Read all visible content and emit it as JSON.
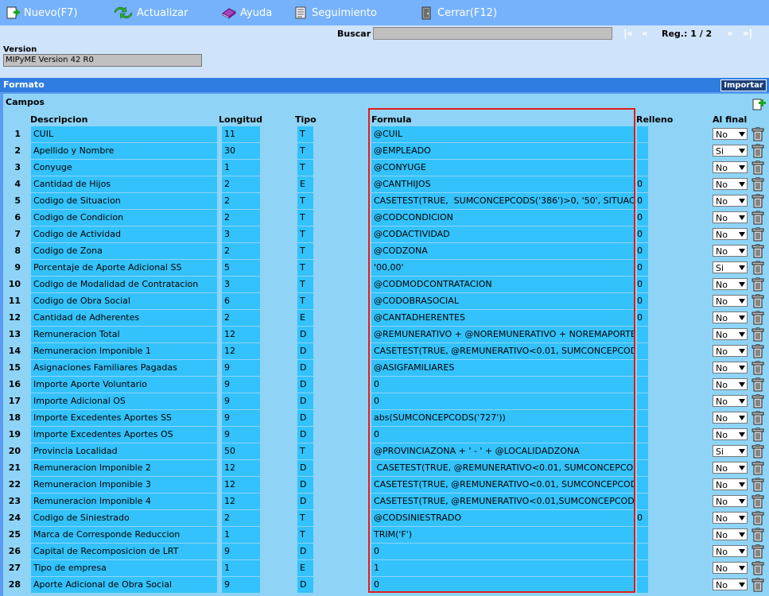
{
  "toolbar": {
    "nuevo": "Nuevo(F7)",
    "actualizar": "Actualizar",
    "ayuda": "Ayuda",
    "seguimiento": "Seguimiento",
    "cerrar": "Cerrar(F12)"
  },
  "search": {
    "label": "Buscar",
    "value": "",
    "nav_first": "|«",
    "nav_prev": "«",
    "reg": "Reg.: 1 / 2",
    "nav_next": "»",
    "nav_last": "»|"
  },
  "version": {
    "label": "Version",
    "value": "MIPyME Version 42 R0"
  },
  "formato": {
    "title": "Formato",
    "importar": "Importar"
  },
  "campos": {
    "title": "Campos",
    "headers": {
      "descripcion": "Descripcion",
      "longitud": "Longitud",
      "tipo": "Tipo",
      "formula": "Formula",
      "relleno": "Relleno",
      "al_final": "Al final"
    },
    "rows": [
      {
        "num": "1",
        "desc": "CUIL",
        "len": "11",
        "tipo": "T",
        "formula": "@CUIL",
        "relleno": "",
        "al_final": "No"
      },
      {
        "num": "2",
        "desc": "Apellido y Nombre",
        "len": "30",
        "tipo": "T",
        "formula": "@EMPLEADO",
        "relleno": "",
        "al_final": "Si"
      },
      {
        "num": "3",
        "desc": "Conyuge",
        "len": "1",
        "tipo": "T",
        "formula": "@CONYUGE",
        "relleno": "",
        "al_final": "No"
      },
      {
        "num": "4",
        "desc": "Cantidad de Hijos",
        "len": "2",
        "tipo": "E",
        "formula": "@CANTHIJOS",
        "relleno": "0",
        "al_final": "No"
      },
      {
        "num": "5",
        "desc": "Codigo de Situacion",
        "len": "2",
        "tipo": "T",
        "formula": "CASETEST(TRUE,  SUMCONCEPCODS('386')>0, '50', SITUACION",
        "relleno": "0",
        "al_final": "No"
      },
      {
        "num": "6",
        "desc": "Codigo de Condicion",
        "len": "2",
        "tipo": "T",
        "formula": "@CODCONDICION",
        "relleno": "0",
        "al_final": "No"
      },
      {
        "num": "7",
        "desc": "Codigo de Actividad",
        "len": "3",
        "tipo": "T",
        "formula": "@CODACTIVIDAD",
        "relleno": "0",
        "al_final": "No"
      },
      {
        "num": "8",
        "desc": "Codigo de Zona",
        "len": "2",
        "tipo": "T",
        "formula": "@CODZONA",
        "relleno": "0",
        "al_final": "No"
      },
      {
        "num": "9",
        "desc": "Porcentaje de Aporte Adicional SS",
        "len": "5",
        "tipo": "T",
        "formula": "'00,00'",
        "relleno": "0",
        "al_final": "Si"
      },
      {
        "num": "10",
        "desc": "Codigo de Modalidad de Contratacion",
        "len": "3",
        "tipo": "T",
        "formula": "@CODMODCONTRATACION",
        "relleno": "0",
        "al_final": "No"
      },
      {
        "num": "11",
        "desc": "Codigo de Obra Social",
        "len": "6",
        "tipo": "T",
        "formula": "@CODOBRASOCIAL",
        "relleno": "0",
        "al_final": "No"
      },
      {
        "num": "12",
        "desc": "Cantidad de Adherentes",
        "len": "2",
        "tipo": "E",
        "formula": "@CANTADHERENTES",
        "relleno": "0",
        "al_final": "No"
      },
      {
        "num": "13",
        "desc": "Remuneracion Total",
        "len": "12",
        "tipo": "D",
        "formula": "@REMUNERATIVO + @NOREMUNERATIVO + NOREMAPORTE",
        "relleno": "",
        "al_final": "No"
      },
      {
        "num": "14",
        "desc": "Remuneracion Imponible 1",
        "len": "12",
        "tipo": "D",
        "formula": "CASETEST(TRUE, @REMUNERATIVO<0.01, SUMCONCEPCODS",
        "relleno": "",
        "al_final": "No"
      },
      {
        "num": "15",
        "desc": "Asignaciones Familiares Pagadas",
        "len": "9",
        "tipo": "D",
        "formula": "@ASIGFAMILIARES",
        "relleno": "",
        "al_final": "No"
      },
      {
        "num": "16",
        "desc": "Importe Aporte Voluntario",
        "len": "9",
        "tipo": "D",
        "formula": "0",
        "relleno": "",
        "al_final": "No"
      },
      {
        "num": "17",
        "desc": "Importe Adicional OS",
        "len": "9",
        "tipo": "D",
        "formula": "0",
        "relleno": "",
        "al_final": "No"
      },
      {
        "num": "18",
        "desc": "Importe Excedentes Aportes SS",
        "len": "9",
        "tipo": "D",
        "formula": "abs(SUMCONCEPCODS('727'))",
        "relleno": "",
        "al_final": "No"
      },
      {
        "num": "19",
        "desc": "Importe Excedentes Aportes OS",
        "len": "9",
        "tipo": "D",
        "formula": "0",
        "relleno": "",
        "al_final": "No"
      },
      {
        "num": "20",
        "desc": "Provincia Localidad",
        "len": "50",
        "tipo": "T",
        "formula": "@PROVINCIAZONA + ' - ' + @LOCALIDADZONA",
        "relleno": "",
        "al_final": "Si"
      },
      {
        "num": "21",
        "desc": "Remuneracion Imponible 2",
        "len": "12",
        "tipo": "D",
        "formula": " CASETEST(TRUE, @REMUNERATIVO<0.01, SUMCONCEPCODS",
        "relleno": "",
        "al_final": "No"
      },
      {
        "num": "22",
        "desc": "Remuneracion Imponible 3",
        "len": "12",
        "tipo": "D",
        "formula": "CASETEST(TRUE, @REMUNERATIVO<0.01, SUMCONCEPCODS",
        "relleno": "",
        "al_final": "No"
      },
      {
        "num": "23",
        "desc": "Remuneracion Imponible 4",
        "len": "12",
        "tipo": "D",
        "formula": "CASETEST(TRUE, @REMUNERATIVO<0.01,SUMCONCEPCODS",
        "relleno": "",
        "al_final": "No"
      },
      {
        "num": "24",
        "desc": "Codigo de Siniestrado",
        "len": "2",
        "tipo": "T",
        "formula": "@CODSINIESTRADO",
        "relleno": "0",
        "al_final": "No"
      },
      {
        "num": "25",
        "desc": "Marca de Corresponde Reduccion",
        "len": "1",
        "tipo": "T",
        "formula": "TRIM('F')",
        "relleno": "",
        "al_final": "No"
      },
      {
        "num": "26",
        "desc": "Capital de Recomposicion de LRT",
        "len": "9",
        "tipo": "D",
        "formula": "0",
        "relleno": "",
        "al_final": "No"
      },
      {
        "num": "27",
        "desc": "Tipo de empresa",
        "len": "1",
        "tipo": "E",
        "formula": "1",
        "relleno": "",
        "al_final": "No"
      },
      {
        "num": "28",
        "desc": "Aporte Adicional de Obra Social",
        "len": "9",
        "tipo": "D",
        "formula": "0",
        "relleno": "",
        "al_final": "No"
      }
    ]
  }
}
